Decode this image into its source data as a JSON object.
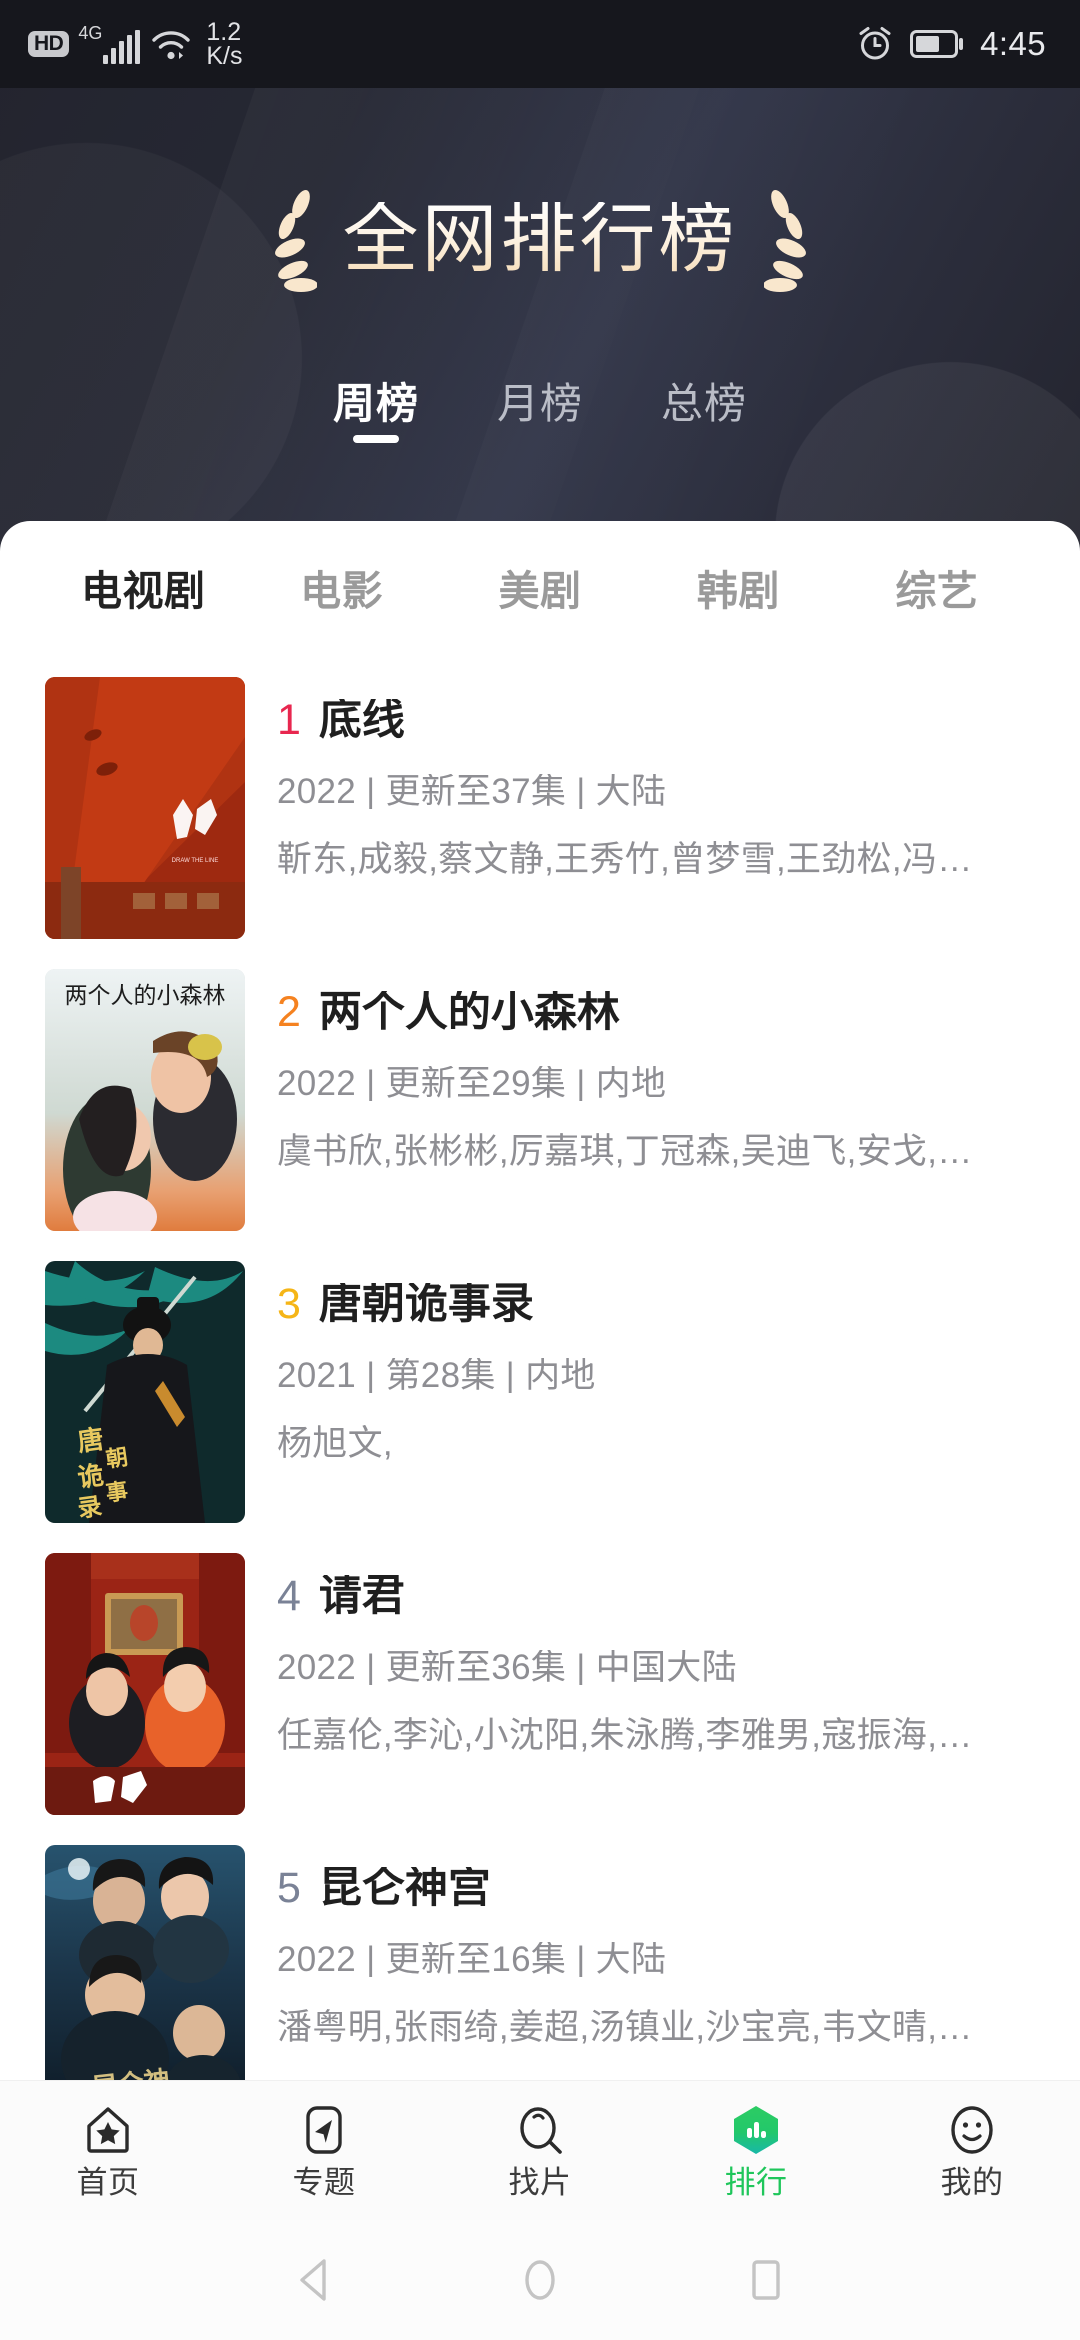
{
  "status_bar": {
    "hd_label": "HD",
    "network_label": "4G",
    "speed_value": "1.2",
    "speed_unit": "K/s",
    "alarm_icon": "alarm-clock-icon",
    "battery_icon": "battery-icon",
    "time": "4:45"
  },
  "hero": {
    "title": "全网排行榜",
    "left_icon": "laurel-branch-icon",
    "right_icon": "laurel-branch-icon",
    "accent_color": "#f6ddb9",
    "background_color": "#2a2c39"
  },
  "period_tabs": [
    {
      "label": "周榜",
      "active": true
    },
    {
      "label": "月榜",
      "active": false
    },
    {
      "label": "总榜",
      "active": false
    }
  ],
  "category_tabs": [
    {
      "label": "电视剧",
      "active": true
    },
    {
      "label": "电影",
      "active": false
    },
    {
      "label": "美剧",
      "active": false
    },
    {
      "label": "韩剧",
      "active": false
    },
    {
      "label": "综艺",
      "active": false
    }
  ],
  "list": [
    {
      "rank": "1",
      "rank_color": "#e8274f",
      "title": "底线",
      "subtitle": "2022 | 更新至37集 | 大陆",
      "cast": "靳东,成毅,蔡文静,王秀竹,曾梦雪,王劲松,冯…",
      "poster_name": "poster-dixian"
    },
    {
      "rank": "2",
      "rank_color": "#f58220",
      "title": "两个人的小森林",
      "subtitle": "2022 | 更新至29集 | 内地",
      "cast": "虞书欣,张彬彬,厉嘉琪,丁冠森,吴迪飞,安戈,…",
      "poster_name": "poster-liangegrenxiaosenlin"
    },
    {
      "rank": "3",
      "rank_color": "#f5b517",
      "title": "唐朝诡事录",
      "subtitle": "2021 | 第28集 | 内地",
      "cast": "杨旭文,",
      "poster_name": "poster-tangchaoguishilu"
    },
    {
      "rank": "4",
      "rank_color": "#7a8296",
      "title": "请君",
      "subtitle": "2022 | 更新至36集 | 中国大陆",
      "cast": "任嘉伦,李沁,小沈阳,朱泳腾,李雅男,寇振海,…",
      "poster_name": "poster-qingjun"
    },
    {
      "rank": "5",
      "rank_color": "#7a8296",
      "title": "昆仑神宫",
      "subtitle": "2022 | 更新至16集 | 大陆",
      "cast": "潘粤明,张雨绮,姜超,汤镇业,沙宝亮,韦文晴,…",
      "poster_name": "poster-kunlunshengong"
    }
  ],
  "bottom_nav": {
    "active_color": "#1fc65b",
    "items": [
      {
        "label": "首页",
        "icon": "home-star-icon",
        "active": false
      },
      {
        "label": "专题",
        "icon": "compass-arrow-icon",
        "active": false
      },
      {
        "label": "找片",
        "icon": "search-icon",
        "active": false
      },
      {
        "label": "排行",
        "icon": "ranking-chart-icon",
        "active": true
      },
      {
        "label": "我的",
        "icon": "smiley-face-icon",
        "active": false
      }
    ]
  },
  "android_nav": [
    {
      "icon": "back-triangle-icon"
    },
    {
      "icon": "home-circle-icon"
    },
    {
      "icon": "recents-square-icon"
    }
  ]
}
